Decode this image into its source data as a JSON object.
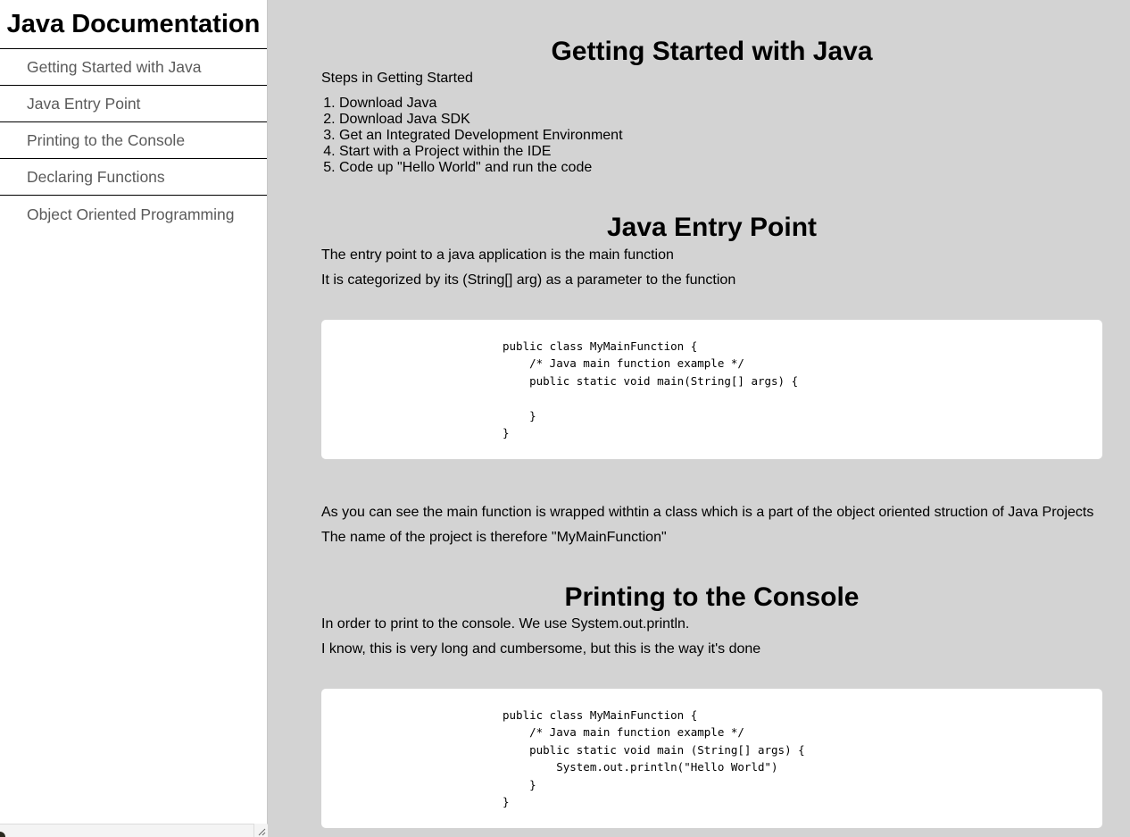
{
  "navbar": {
    "title": "Java Documentation",
    "items": [
      {
        "label": "Getting Started with Java"
      },
      {
        "label": "Java Entry Point"
      },
      {
        "label": "Printing to the Console"
      },
      {
        "label": "Declaring Functions"
      },
      {
        "label": "Object Oriented Programming"
      }
    ]
  },
  "sections": {
    "getting_started": {
      "title": "Getting Started with Java",
      "intro": "Steps in Getting Started",
      "steps": [
        "Download Java",
        "Download Java SDK",
        "Get an Integrated Development Environment",
        "Start with a Project within the IDE",
        "Code up \"Hello World\" and run the code"
      ]
    },
    "entry_point": {
      "title": "Java Entry Point",
      "p1": "The entry point to a java application is the main function",
      "p2": "It is categorized by its (String[] arg) as a parameter to the function",
      "code": "public class MyMainFunction {\n    /* Java main function example */\n    public static void main(String[] args) {\n\n    }\n}",
      "p3": "As you can see the main function is wrapped withtin a class which is a part of the object oriented struction of Java Projects",
      "p4": "The name of the project is therefore \"MyMainFunction\""
    },
    "printing": {
      "title": "Printing to the Console",
      "p1": "In order to print to the console. We use System.out.println.",
      "p2": "I know, this is very long and cumbersome, but this is the way it's done",
      "code": "public class MyMainFunction {\n    /* Java main function example */\n    public static void main (String[] args) {\n        System.out.println(\"Hello World\")\n    }\n}"
    }
  }
}
